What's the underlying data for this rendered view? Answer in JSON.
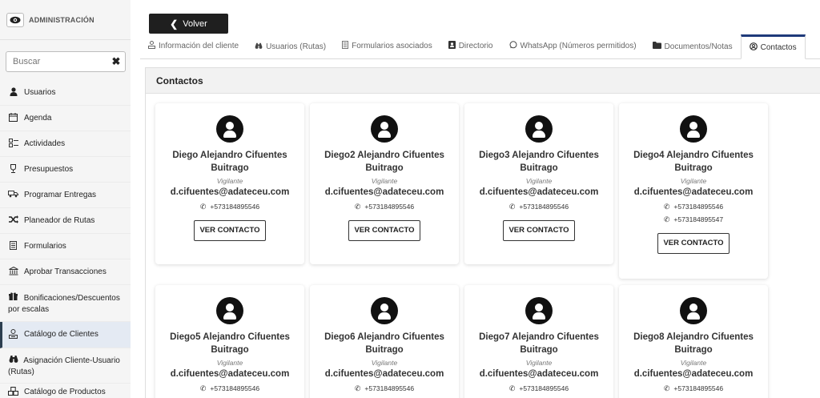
{
  "sidebar": {
    "admin_label": "ADMINISTRACIÓN",
    "search_placeholder": "Buscar",
    "items": [
      {
        "label": "Usuarios",
        "icon": "user-icon"
      },
      {
        "label": "Agenda",
        "icon": "calendar-icon"
      },
      {
        "label": "Actividades",
        "icon": "activities-icon"
      },
      {
        "label": "Presupuestos",
        "icon": "trophy-icon"
      },
      {
        "label": "Programar Entregas",
        "icon": "truck-icon"
      },
      {
        "label": "Planeador de Rutas",
        "icon": "random-icon"
      },
      {
        "label": "Formularios",
        "icon": "form-icon"
      },
      {
        "label": "Aprobar Transacciones",
        "icon": "bank-icon"
      },
      {
        "label": "Bonificaciones/Descuentos por escalas",
        "icon": "gift-icon"
      },
      {
        "label": "Catálogo de Clientes",
        "icon": "client-catalog-icon"
      },
      {
        "label": "Asignación Cliente-Usuario (Rutas)",
        "icon": "binoculars-icon"
      },
      {
        "label": "Catálogo de Productos",
        "icon": "boxes-icon"
      }
    ]
  },
  "header": {
    "back_label": "Volver"
  },
  "tabs": [
    {
      "label": "Información del cliente",
      "icon": "client-info-icon"
    },
    {
      "label": "Usuarios (Rutas)",
      "icon": "binoculars-icon"
    },
    {
      "label": "Formularios asociados",
      "icon": "form-icon"
    },
    {
      "label": "Directorio",
      "icon": "directory-icon"
    },
    {
      "label": "WhatsApp (Números permitidos)",
      "icon": "whatsapp-icon"
    },
    {
      "label": "Documentos/Notas",
      "icon": "folder-icon"
    },
    {
      "label": "Contactos",
      "icon": "user-circle-icon",
      "active": true
    }
  ],
  "panel": {
    "title": "Contactos"
  },
  "contacts": [
    {
      "name": "Diego Alejandro Cifuentes Buitrago",
      "role": "Vigilante",
      "email": "d.cifuentes@adateceu.com",
      "whatsapp": "+573184895546",
      "phone": "",
      "button": "VER CONTACTO"
    },
    {
      "name": "Diego2 Alejandro Cifuentes Buitrago",
      "role": "Vigilante",
      "email": "d.cifuentes@adateceu.com",
      "whatsapp": "+573184895546",
      "phone": "",
      "button": "VER CONTACTO"
    },
    {
      "name": "Diego3 Alejandro Cifuentes Buitrago",
      "role": "Vigilante",
      "email": "d.cifuentes@adateceu.com",
      "whatsapp": "+573184895546",
      "phone": "",
      "button": "VER CONTACTO"
    },
    {
      "name": "Diego4 Alejandro Cifuentes Buitrago",
      "role": "Vigilante",
      "email": "d.cifuentes@adateceu.com",
      "whatsapp": "+573184895546",
      "phone": "+573184895547",
      "button": "VER CONTACTO"
    },
    {
      "name": "Diego5 Alejandro Cifuentes Buitrago",
      "role": "Vigilante",
      "email": "d.cifuentes@adateceu.com",
      "whatsapp": "+573184895546",
      "phone": "",
      "button": "VER CONTACTO"
    },
    {
      "name": "Diego6 Alejandro Cifuentes Buitrago",
      "role": "Vigilante",
      "email": "d.cifuentes@adateceu.com",
      "whatsapp": "+573184895546",
      "phone": "",
      "button": "VER CONTACTO"
    },
    {
      "name": "Diego7 Alejandro Cifuentes Buitrago",
      "role": "Vigilante",
      "email": "d.cifuentes@adateceu.com",
      "whatsapp": "+573184895546",
      "phone": "",
      "button": "VER CONTACTO"
    },
    {
      "name": "Diego8 Alejandro Cifuentes Buitrago",
      "role": "Vigilante",
      "email": "d.cifuentes@adateceu.com",
      "whatsapp": "+573184895546",
      "phone": "",
      "button": "VER CONTACTO"
    }
  ]
}
